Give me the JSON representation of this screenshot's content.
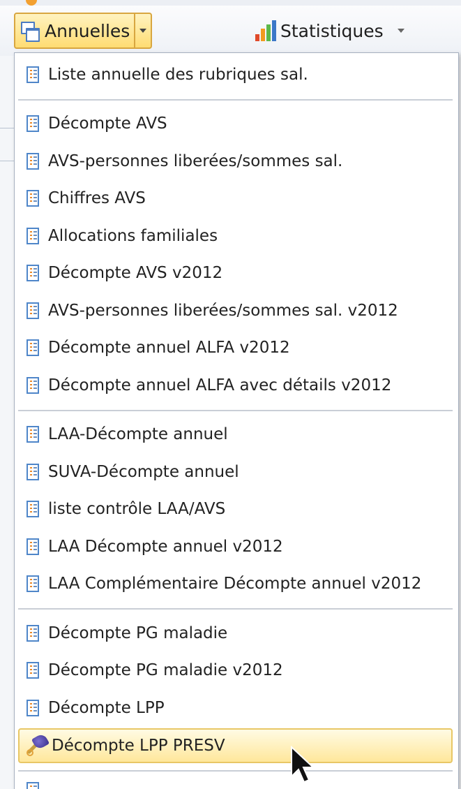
{
  "ribbon": {
    "annuelles_label": "Annuelles",
    "statistiques_label": "Statistiques"
  },
  "menu": {
    "items": [
      {
        "label": "Liste annuelle des rubriques sal.",
        "icon": "report-list-icon"
      },
      {
        "label": "Décompte AVS",
        "icon": "report-list-icon"
      },
      {
        "label": "AVS-personnes liberées/sommes sal.",
        "icon": "report-list-icon"
      },
      {
        "label": "Chiffres AVS",
        "icon": "report-list-icon"
      },
      {
        "label": "Allocations familiales",
        "icon": "report-list-icon"
      },
      {
        "label": "Décompte AVS v2012",
        "icon": "report-list-icon"
      },
      {
        "label": "AVS-personnes liberées/sommes sal. v2012",
        "icon": "report-list-icon"
      },
      {
        "label": "Décompte annuel ALFA v2012",
        "icon": "report-list-icon"
      },
      {
        "label": "Décompte annuel ALFA avec détails v2012",
        "icon": "report-list-icon"
      },
      {
        "label": "LAA-Décompte annuel",
        "icon": "report-list-icon"
      },
      {
        "label": "SUVA-Décompte annuel",
        "icon": "report-list-icon"
      },
      {
        "label": "liste contrôle LAA/AVS",
        "icon": "report-list-icon"
      },
      {
        "label": "LAA Décompte annuel v2012",
        "icon": "report-list-icon"
      },
      {
        "label": "LAA Complémentaire Décompte annuel v2012",
        "icon": "report-list-icon"
      },
      {
        "label": "Décompte PG maladie",
        "icon": "report-list-icon"
      },
      {
        "label": "Décompte PG maladie v2012",
        "icon": "report-list-icon"
      },
      {
        "label": "Décompte LPP",
        "icon": "report-list-icon"
      },
      {
        "label": "Décompte LPP PRESV",
        "icon": "brush-icon",
        "highlighted": true
      }
    ]
  },
  "colors": {
    "highlight_fill": "#ffe79b",
    "highlight_border": "#e8c766",
    "split_button_fill": "#ffdc73"
  }
}
